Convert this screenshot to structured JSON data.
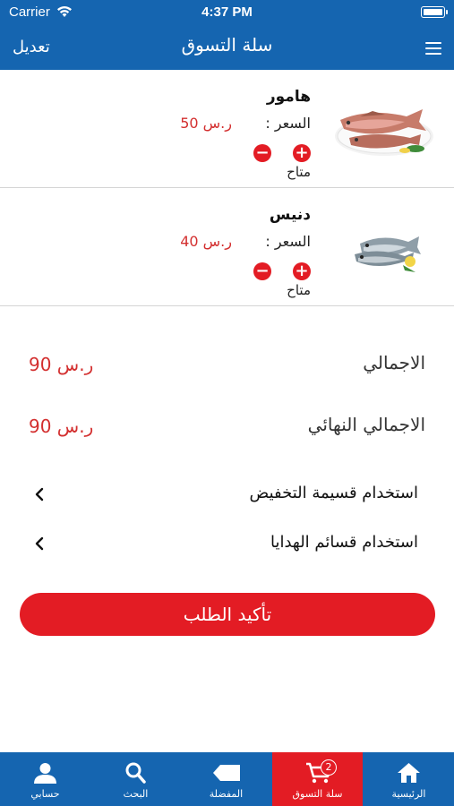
{
  "status_bar": {
    "carrier": "Carrier",
    "time": "4:37 PM",
    "battery_level": 1.0
  },
  "nav": {
    "title": "سلة التسوق",
    "edit_label": "تعديل"
  },
  "items": [
    {
      "name": "هامور",
      "price_label": "السعر :",
      "price_value": "ر.س 50",
      "availability": "متاح",
      "image": "hamour-fish-image"
    },
    {
      "name": "دنيس",
      "price_label": "السعر :",
      "price_value": "ر.س 40",
      "availability": "متاح",
      "image": "denis-fish-image"
    }
  ],
  "totals": {
    "total_label": "الاجمالي",
    "total_value": "ر.س 90",
    "final_label": "الاجمالي النهائي",
    "final_value": "ر.س 90"
  },
  "links": {
    "discount_coupon": "استخدام قسيمة التخفيض",
    "gift_vouchers": "استخدام قسائم الهدايا"
  },
  "confirm_label": "تأكيد الطلب",
  "tabs": [
    {
      "label": "حسابي",
      "icon": "user-icon"
    },
    {
      "label": "البحث",
      "icon": "search-icon"
    },
    {
      "label": "المفضلة",
      "icon": "tag-icon"
    },
    {
      "label": "سلة التسوق",
      "icon": "cart-icon",
      "badge": "2",
      "active": true
    },
    {
      "label": "الرئيسية",
      "icon": "home-icon"
    }
  ],
  "colors": {
    "primary": "#1565b0",
    "accent": "#e31c24",
    "price": "#d32f2f"
  }
}
